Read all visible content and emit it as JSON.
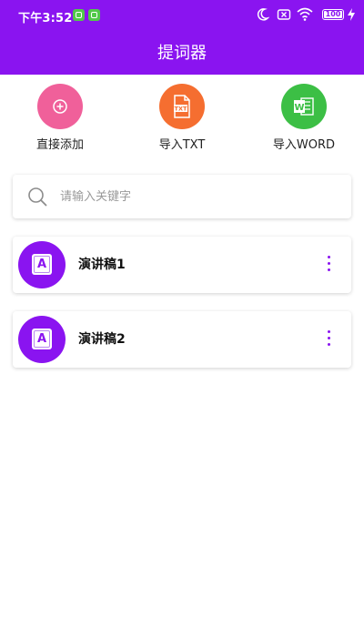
{
  "status_bar": {
    "time": "下午3:52",
    "battery": "100"
  },
  "header": {
    "title": "提词器"
  },
  "actions": [
    {
      "label": "直接添加",
      "icon": "plus-icon",
      "color": "#f0609a"
    },
    {
      "label": "导入TXT",
      "icon": "txt-file-icon",
      "color": "#f56e30",
      "icon_text": "TXT"
    },
    {
      "label": "导入WORD",
      "icon": "word-file-icon",
      "color": "#3cbf45",
      "icon_text": "W"
    }
  ],
  "search": {
    "placeholder": "请输入关键字",
    "icon": "search-icon"
  },
  "documents": [
    {
      "title": "演讲稿1",
      "avatar_letter": "A"
    },
    {
      "title": "演讲稿2",
      "avatar_letter": "A"
    }
  ],
  "colors": {
    "primary": "#8a14f0"
  }
}
